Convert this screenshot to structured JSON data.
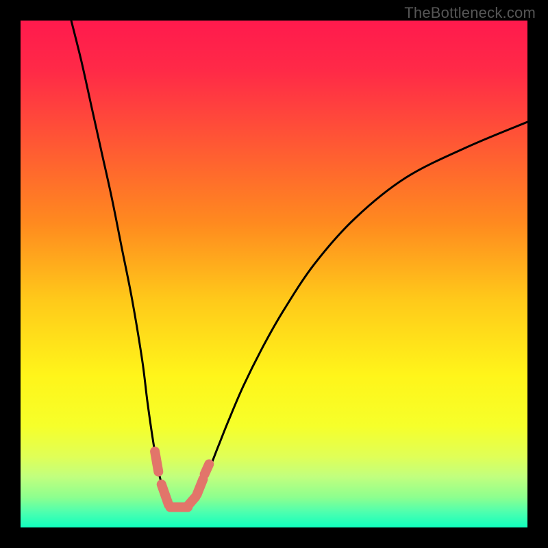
{
  "watermark": "TheBottleneck.com",
  "chart_data": {
    "type": "line",
    "title": "",
    "xlabel": "",
    "ylabel": "",
    "xlim": [
      0,
      100
    ],
    "ylim": [
      0,
      100
    ],
    "gradient_stops": [
      {
        "offset": 0.0,
        "color": "#ff1a4d"
      },
      {
        "offset": 0.1,
        "color": "#ff2a47"
      },
      {
        "offset": 0.25,
        "color": "#ff5a33"
      },
      {
        "offset": 0.4,
        "color": "#ff8a1f"
      },
      {
        "offset": 0.55,
        "color": "#ffc91a"
      },
      {
        "offset": 0.7,
        "color": "#fff51a"
      },
      {
        "offset": 0.8,
        "color": "#f6ff2a"
      },
      {
        "offset": 0.86,
        "color": "#e0ff57"
      },
      {
        "offset": 0.9,
        "color": "#c1ff7e"
      },
      {
        "offset": 0.94,
        "color": "#8eff8e"
      },
      {
        "offset": 0.97,
        "color": "#4dffaf"
      },
      {
        "offset": 1.0,
        "color": "#10ffbe"
      }
    ],
    "series": [
      {
        "name": "bottleneck-curve",
        "x": [
          10.0,
          12.0,
          14.0,
          16.0,
          18.0,
          20.0,
          22.0,
          24.0,
          25.0,
          26.0,
          27.0,
          28.0,
          29.0,
          30.0,
          31.0,
          32.0,
          33.0,
          34.0,
          35.0,
          37.0,
          39.0,
          41.0,
          44.0,
          48.0,
          52.0,
          58.0,
          66.0,
          76.0,
          88.0,
          100.0
        ],
        "y": [
          100.0,
          92.0,
          83.0,
          74.0,
          65.0,
          55.0,
          45.0,
          33.0,
          25.0,
          18.0,
          12.0,
          8.0,
          5.0,
          4.0,
          3.5,
          3.5,
          4.0,
          5.0,
          7.0,
          11.0,
          16.0,
          21.0,
          28.0,
          36.0,
          43.0,
          52.0,
          61.0,
          69.0,
          75.0,
          80.0
        ]
      },
      {
        "name": "marker-segments",
        "color": "#e2756a",
        "segments": [
          {
            "x": [
              26.5,
              27.2
            ],
            "y": [
              15.0,
              11.0
            ]
          },
          {
            "x": [
              27.8,
              29.2
            ],
            "y": [
              8.5,
              4.5
            ]
          },
          {
            "x": [
              29.5,
              33.0
            ],
            "y": [
              4.0,
              4.0
            ]
          },
          {
            "x": [
              33.2,
              34.5
            ],
            "y": [
              4.5,
              6.0
            ]
          },
          {
            "x": [
              34.8,
              36.0
            ],
            "y": [
              6.5,
              9.5
            ]
          },
          {
            "x": [
              36.3,
              37.2
            ],
            "y": [
              10.5,
              12.5
            ]
          }
        ]
      }
    ]
  }
}
